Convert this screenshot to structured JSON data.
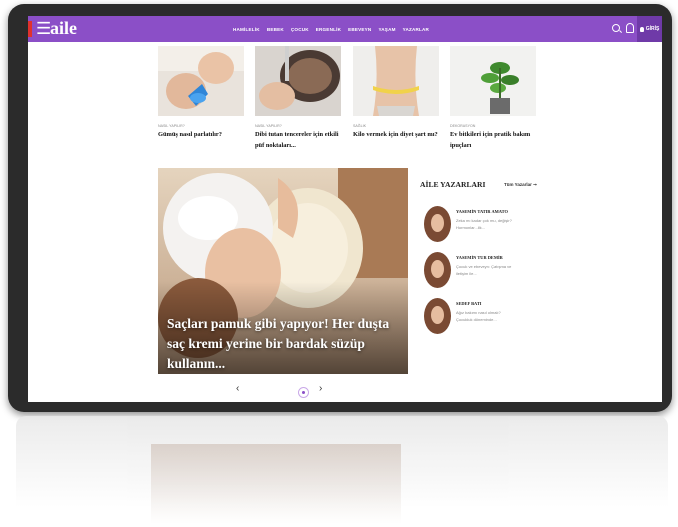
{
  "header": {
    "logo": "aile",
    "nav": [
      "HAMİLELİK",
      "BEBEK",
      "ÇOCUK",
      "ERGENLİK",
      "EBEVEYN",
      "YAŞAM",
      "YAZARLAR"
    ],
    "login_label": "GİRİŞ"
  },
  "cards": [
    {
      "category": "Nasıl Yapılır?",
      "title": "Gümüş nasıl parlatılır?"
    },
    {
      "category": "Nasıl Yapılır?",
      "title": "Dibi tutan tencereler için etkili püf noktaları..."
    },
    {
      "category": "Sağlık",
      "title": "Kilo vermek için diyet şart mı?"
    },
    {
      "category": "Dekorasyon",
      "title": "Ev bitkileri için pratik bakım ipuçları"
    }
  ],
  "hero": {
    "title": "Saçları pamuk gibi yapıyor! Her duşta saç kremi yerine bir bardak süzüp kullanın..."
  },
  "writers": {
    "heading": "AİLE YAZARLARI",
    "all_link": "Tüm Yazarlar ➞",
    "items": [
      {
        "name": "YASEMİN TATIR AMATO",
        "desc": "Zeka mı kadar çok mu, değişir? Hormonlar...ilk..."
      },
      {
        "name": "YASEMİN TUR DEMİR",
        "desc": "Çocuk ve ebeveyn: Çatışma ve iletişim ile..."
      },
      {
        "name": "SEDEF BATI",
        "desc": "Ağız bakımı nasıl olmalı? Çocukluk döneminde..."
      }
    ]
  },
  "pager": {
    "prev": "‹",
    "next": "›"
  }
}
